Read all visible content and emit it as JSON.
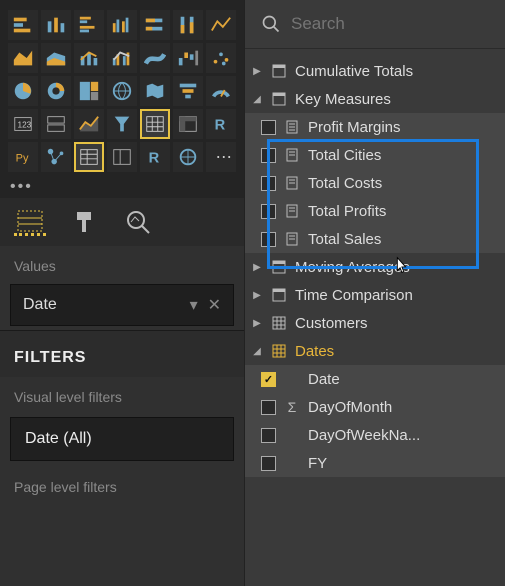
{
  "search": {
    "placeholder": "Search"
  },
  "values": {
    "label": "Values",
    "item": "Date"
  },
  "filters": {
    "header": "FILTERS",
    "visual_label": "Visual level filters",
    "visual_item": "Date (All)",
    "page_label": "Page level filters"
  },
  "tree": {
    "cumulative": "Cumulative Totals",
    "key_measures": "Key Measures",
    "profit_margins": "Profit Margins",
    "total_cities": "Total Cities",
    "total_costs": "Total Costs",
    "total_profits": "Total Profits",
    "total_sales": "Total Sales",
    "moving_avg": "Moving Averages",
    "time_comp": "Time Comparison",
    "customers": "Customers",
    "dates": "Dates",
    "date": "Date",
    "day_of_month": "DayOfMonth",
    "day_of_week": "DayOfWeekNa...",
    "fy": "FY"
  },
  "ellipsis": "•••"
}
